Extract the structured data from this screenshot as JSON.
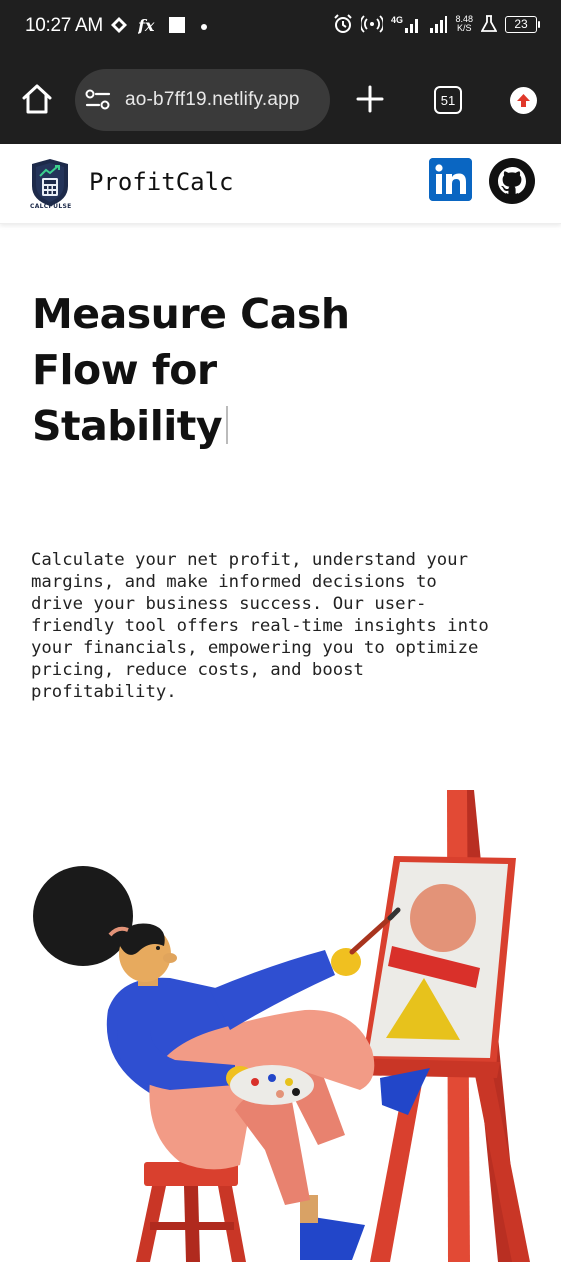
{
  "status_bar": {
    "time": "10:27 AM",
    "network": "4G",
    "net_speed_value": "8.48",
    "net_speed_unit": "K/S",
    "battery": "23"
  },
  "browser": {
    "url": "ao-b7ff19.netlify.app",
    "tab_count": "51"
  },
  "site": {
    "logo_text": "CALCPULSE",
    "brand": "ProfitCalc"
  },
  "hero": {
    "title_line1": "Measure Cash",
    "title_line2": "Flow for",
    "title_line3": "Stability",
    "description": "Calculate your net profit, understand your\nmargins, and make informed decisions to\ndrive your business success. Our user-\nfriendly tool offers real-time insights into\nyour financials, empowering you to optimize\npricing, reduce costs, and boost\nprofitability."
  },
  "colors": {
    "toolbar_bg": "#1f1f1f",
    "url_pill_bg": "#3a3a3a",
    "linkedin_blue": "#0a66c2",
    "easel_red": "#d9402e",
    "update_red": "#e0382a"
  }
}
